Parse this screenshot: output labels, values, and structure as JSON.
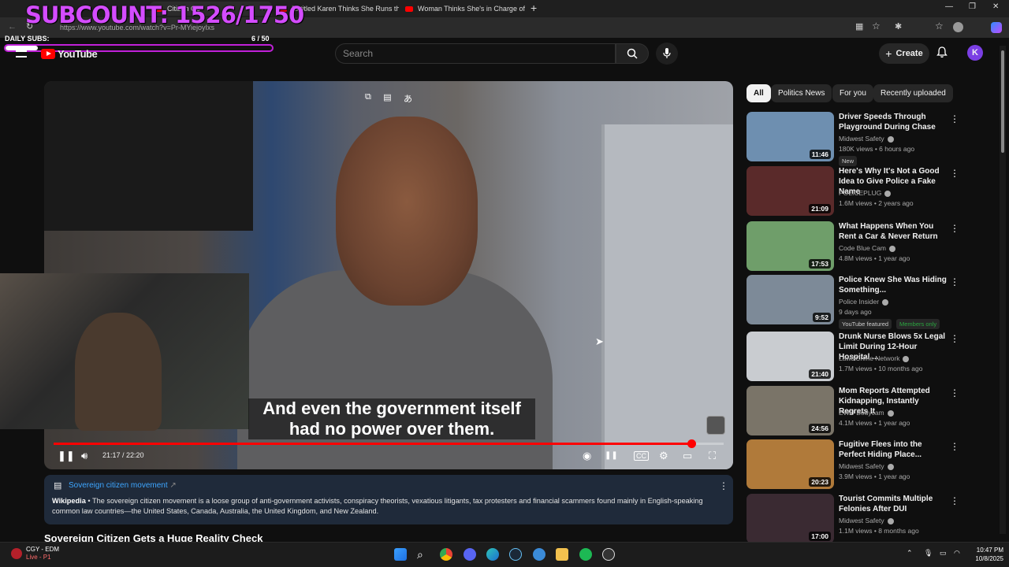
{
  "browser": {
    "tabs": [
      {
        "title": "",
        "partial": "Citizen Ge"
      },
      {
        "title": "Entitled Karen Thinks She Runs th"
      },
      {
        "title": "Woman Thinks She's in Charge of"
      }
    ],
    "url": "https://www.youtube.com/watch?v=Pr-MYiejoyIxs"
  },
  "overlay": {
    "subcount": "SUBCOUNT: 1526/1750",
    "daily_label": "DAILY SUBS:",
    "daily_count": "6  / 50",
    "daily_progress": 0.12,
    "accent": "#d44cff"
  },
  "header": {
    "logo": "YouTube",
    "search_placeholder": "Search",
    "create_label": "Create",
    "account_initial": "K"
  },
  "player": {
    "subtitle_line1": "And even the government itself",
    "subtitle_line2": "had no power over them.",
    "time": "21:17 / 22:20",
    "progress": 0.952
  },
  "info_card": {
    "title": "Sovereign citizen movement",
    "source": "Wikipedia",
    "text": "The sovereign citizen movement is a loose group of anti-government activists, conspiracy theorists, vexatious litigants, tax protesters and financial scammers found mainly in English-speaking common law countries—the United States, Canada, Australia, the United Kingdom, and New Zealand."
  },
  "video_title": "Sovereign Citizen Gets a Huge Reality Check",
  "chips": [
    "All",
    "Politics News",
    "For you",
    "Recently uploaded"
  ],
  "recommendations": [
    {
      "title": "Driver Speeds Through Playground During Chase",
      "channel": "Midwest Safety",
      "meta": "180K views • 6 hours ago",
      "duration": "11:46",
      "badge": "New",
      "thumb": "#6e8fb0"
    },
    {
      "title": "Here's Why It's Not a Good Idea to Give Police a Fake Name",
      "channel": "POLICEPLUG",
      "meta": "1.6M views • 2 years ago",
      "duration": "21:09",
      "thumb": "#5a2a2a"
    },
    {
      "title": "What Happens When You Rent a Car & Never Return",
      "channel": "Code Blue Cam",
      "meta": "4.8M views • 1 year ago",
      "duration": "17:53",
      "thumb": "#6f9e6a"
    },
    {
      "title": "Police Knew She Was Hiding Something...",
      "channel": "Police Insider",
      "meta": "9 days ago",
      "duration": "9:52",
      "badge": "YouTube featured",
      "badge2": "Members only",
      "thumb": "#7d8a98"
    },
    {
      "title": "Drunk Nurse Blows 5x Legal Limit During 12-Hour Hospital ...",
      "channel": "Law&Crime Network",
      "meta": "1.7M views • 10 months ago",
      "duration": "21:40",
      "thumb": "#c9ccd0"
    },
    {
      "title": "Mom Reports Attempted Kidnapping, Instantly Regrets It",
      "channel": "EWU Bodycam",
      "meta": "4.1M views • 1 year ago",
      "duration": "24:56",
      "thumb": "#7a7468"
    },
    {
      "title": "Fugitive Flees into the Perfect Hiding Place...",
      "channel": "Midwest Safety",
      "meta": "3.9M views • 1 year ago",
      "duration": "20:23",
      "thumb": "#b07a3a"
    },
    {
      "title": "Tourist Commits Multiple Felonies After DUI",
      "channel": "Midwest Safety",
      "meta": "1.1M views • 8 months ago",
      "duration": "17:00",
      "thumb": "#3a2a32"
    }
  ],
  "taskbar": {
    "weather_line1": "CGY - EDM",
    "weather_line2": "Live - P1",
    "time": "10:47 PM",
    "date": "10/8/2025"
  }
}
